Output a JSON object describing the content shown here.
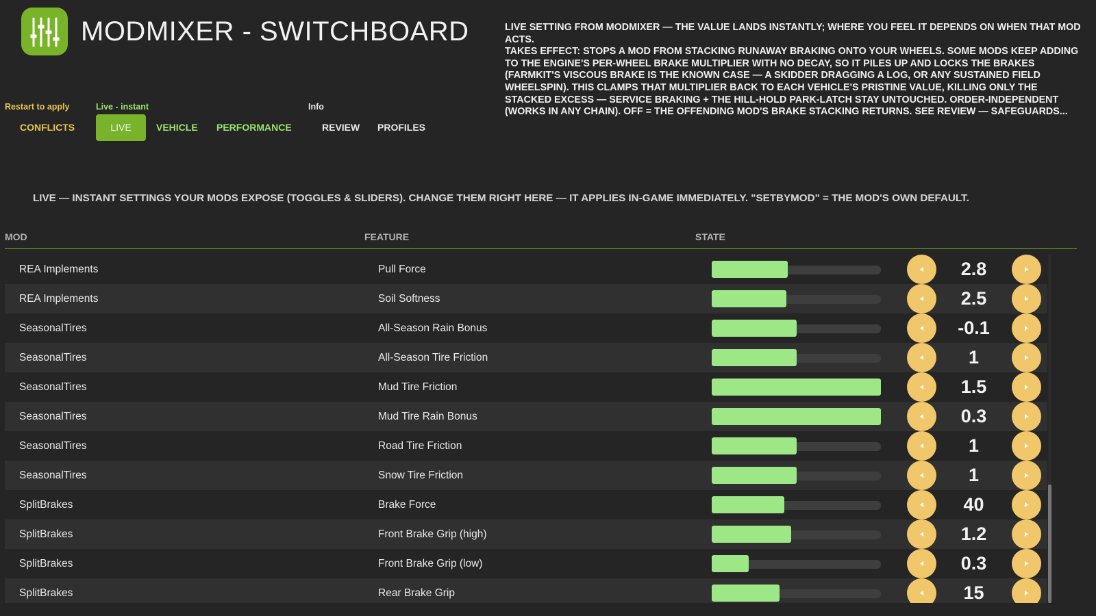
{
  "app": {
    "title": "MODMIXER - SWITCHBOARD",
    "logo_icon": "sliders-icon",
    "accent_color": "#78b32a"
  },
  "description": {
    "line1": "LIVE SETTING FROM MODMIXER — THE VALUE LANDS INSTANTLY; WHERE YOU FEEL IT DEPENDS ON WHEN THAT MOD ACTS.",
    "line2": "TAKES EFFECT: STOPS A MOD FROM STACKING RUNAWAY BRAKING ONTO YOUR WHEELS. SOME MODS KEEP ADDING TO THE ENGINE'S PER-WHEEL BRAKE MULTIPLIER WITH NO DECAY, SO IT PILES UP AND LOCKS THE BRAKES (FARMKIT'S VISCOUS BRAKE IS THE KNOWN CASE — A SKIDDER DRAGGING A LOG, OR ANY SUSTAINED FIELD WHEELSPIN). THIS CLAMPS THAT MULTIPLIER BACK TO EACH VEHICLE'S PRISTINE VALUE, KILLING ONLY THE STACKED EXCESS — SERVICE BRAKING + THE HILL-HOLD PARK-LATCH STAY UNTOUCHED. ORDER-INDEPENDENT (WORKS IN ANY CHAIN). OFF = THE OFFENDING MOD'S BRAKE STACKING RETURNS. SEE REVIEW — SAFEGUARDS..."
  },
  "tab_groups": {
    "restart": {
      "label": "Restart to apply",
      "color": "#e8c34f"
    },
    "live": {
      "label": "Live - instant",
      "color": "#9be36d"
    },
    "info": {
      "label": "Info",
      "color": "#e6e6e6"
    }
  },
  "tabs": {
    "conflicts": "CONFLICTS",
    "live": "LIVE",
    "vehicle": "VEHICLE",
    "performance": "PERFORMANCE",
    "review": "REVIEW",
    "profiles": "PROFILES"
  },
  "intro": "LIVE — INSTANT SETTINGS YOUR MODS EXPOSE (TOGGLES & SLIDERS). CHANGE THEM RIGHT HERE — IT APPLIES IN-GAME IMMEDIATELY. \"SETBYMOD\" = THE MOD'S OWN DEFAULT.",
  "columns": {
    "mod": "MOD",
    "feature": "FEATURE",
    "state": "STATE"
  },
  "colors": {
    "slider_fill": "#9ee787",
    "stepper": "#f1c76b"
  },
  "rows": [
    {
      "mod": "REA Implements",
      "feature": "Pull Force",
      "value": "2.8",
      "fill_fraction": 0.45
    },
    {
      "mod": "REA Implements",
      "feature": "Soil Softness",
      "value": "2.5",
      "fill_fraction": 0.44
    },
    {
      "mod": "SeasonalTires",
      "feature": "All-Season Rain Bonus",
      "value": "-0.1",
      "fill_fraction": 0.5
    },
    {
      "mod": "SeasonalTires",
      "feature": "All-Season Tire Friction",
      "value": "1",
      "fill_fraction": 0.5
    },
    {
      "mod": "SeasonalTires",
      "feature": "Mud Tire Friction",
      "value": "1.5",
      "fill_fraction": 1.0
    },
    {
      "mod": "SeasonalTires",
      "feature": "Mud Tire Rain Bonus",
      "value": "0.3",
      "fill_fraction": 1.0
    },
    {
      "mod": "SeasonalTires",
      "feature": "Road Tire Friction",
      "value": "1",
      "fill_fraction": 0.5
    },
    {
      "mod": "SeasonalTires",
      "feature": "Snow Tire Friction",
      "value": "1",
      "fill_fraction": 0.5
    },
    {
      "mod": "SplitBrakes",
      "feature": "Brake Force",
      "value": "40",
      "fill_fraction": 0.43
    },
    {
      "mod": "SplitBrakes",
      "feature": "Front Brake Grip (high)",
      "value": "1.2",
      "fill_fraction": 0.47
    },
    {
      "mod": "SplitBrakes",
      "feature": "Front Brake Grip (low)",
      "value": "0.3",
      "fill_fraction": 0.22
    },
    {
      "mod": "SplitBrakes",
      "feature": "Rear Brake Grip",
      "value": "15",
      "fill_fraction": 0.4
    }
  ]
}
